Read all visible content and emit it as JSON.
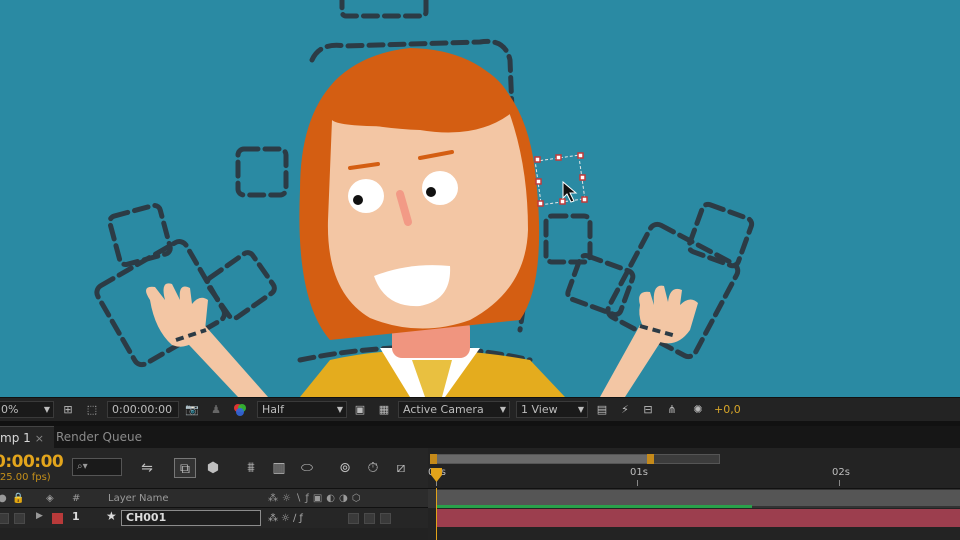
{
  "viewer": {
    "background": "#2a8aa3",
    "hair_color": "#d45e12",
    "skin_color": "#f3c6a4",
    "shirt_color": "#e4ac1e",
    "nose_color": "#f29a86"
  },
  "viewer_toolbar": {
    "zoom": "0%",
    "timecode": "0:00:00:00",
    "resolution": "Half",
    "view": "Active Camera",
    "layout": "1 View",
    "exposure": "+0,0",
    "accent": "#d6a52a"
  },
  "tabs": [
    {
      "label": "mp 1",
      "active": true,
      "close": "×"
    },
    {
      "label": "Render Queue",
      "active": false
    }
  ],
  "timeline": {
    "current_time": "0:00:00",
    "fps": "(25.00 fps)",
    "ruler_labels": [
      "00s",
      "01s",
      "02s"
    ],
    "columns": {
      "number": "#",
      "layer_name": "Layer Name"
    },
    "layers": [
      {
        "index": "1",
        "name": "CH001",
        "label_color": "#b83a3a"
      }
    ],
    "layer_bar_color": "#9c3e4e",
    "cti_color": "#e2a31a"
  }
}
